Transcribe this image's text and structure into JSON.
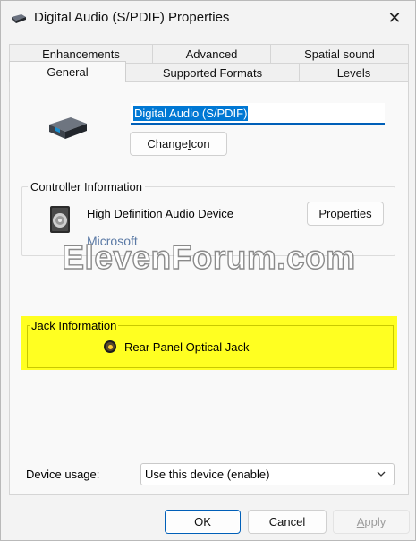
{
  "window": {
    "title": "Digital Audio (S/PDIF) Properties",
    "close_glyph": "✕"
  },
  "tabs": {
    "row_back": [
      "Enhancements",
      "Advanced",
      "Spatial sound"
    ],
    "row_front": [
      "General",
      "Supported Formats",
      "Levels"
    ],
    "active": "General"
  },
  "general": {
    "device_name": "Digital Audio (S/PDIF)",
    "change_icon_pre": "Change ",
    "change_icon_accel": "I",
    "change_icon_post": "con"
  },
  "controller": {
    "group_label": "Controller Information",
    "name": "High Definition Audio Device",
    "vendor": "Microsoft",
    "properties_accel": "P",
    "properties_post": "roperties"
  },
  "watermark": "ElevenForum.com",
  "jack": {
    "group_label": "Jack Information",
    "item": "Rear Panel Optical Jack"
  },
  "usage": {
    "label": "Device usage:",
    "value": "Use this device (enable)"
  },
  "footer": {
    "ok": "OK",
    "cancel": "Cancel",
    "apply_accel": "A",
    "apply_post": "pply"
  },
  "colors": {
    "accent": "#005fb8",
    "highlight": "#ffff21",
    "vendor_text": "#5a79a5"
  }
}
